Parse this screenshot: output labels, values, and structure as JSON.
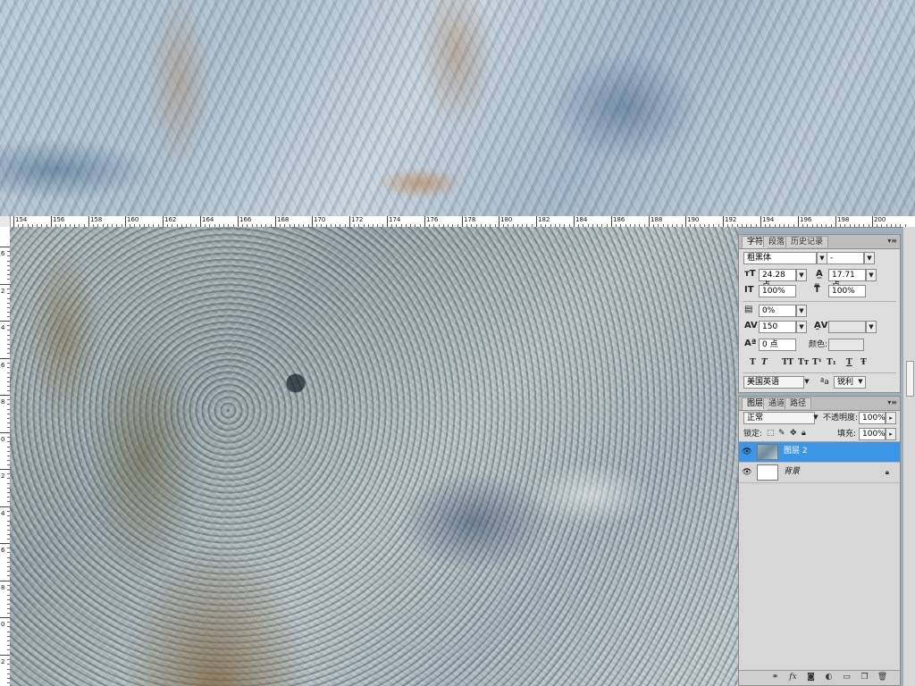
{
  "ruler": {
    "h_labels": [
      "154",
      "156",
      "158",
      "160",
      "162",
      "164",
      "166",
      "168",
      "170",
      "172",
      "174",
      "176",
      "178",
      "180",
      "182",
      "184",
      "186",
      "188",
      "190",
      "192",
      "194",
      "196",
      "198",
      "200"
    ],
    "v_labels": [
      "6",
      "2",
      "4",
      "6",
      "8",
      "0",
      "2",
      "4",
      "6",
      "8",
      "0",
      "2"
    ]
  },
  "character_panel": {
    "tabs": [
      "字符",
      "段落",
      "历史记录"
    ],
    "font_family": "粗黑体",
    "font_style": "-",
    "font_size": "24.28 点",
    "leading": "17.71 点",
    "vertical_scale": "100%",
    "horizontal_scale": "100%",
    "tsume": "0%",
    "tracking": "150",
    "kerning": "",
    "baseline_shift": "0 点",
    "color_label": "颜色:",
    "format_buttons": [
      "T",
      "T",
      "TT",
      "Tт",
      "T¹",
      "T₁",
      "T",
      "Ŧ"
    ],
    "language": "美国英语",
    "aa_label": "ªa",
    "antialias": "锐利"
  },
  "layers_panel": {
    "tabs": [
      "图层",
      "通道",
      "路径"
    ],
    "blend_mode": "正常",
    "opacity_label": "不透明度:",
    "opacity": "100%",
    "lock_label": "锁定:",
    "fill_label": "填充:",
    "fill": "100%",
    "layers": [
      {
        "name": "图层 2",
        "selected": true
      },
      {
        "name": "背景",
        "selected": false
      }
    ]
  },
  "colors": {
    "selection": "#3d95e6",
    "panel_bg": "#dedede"
  }
}
